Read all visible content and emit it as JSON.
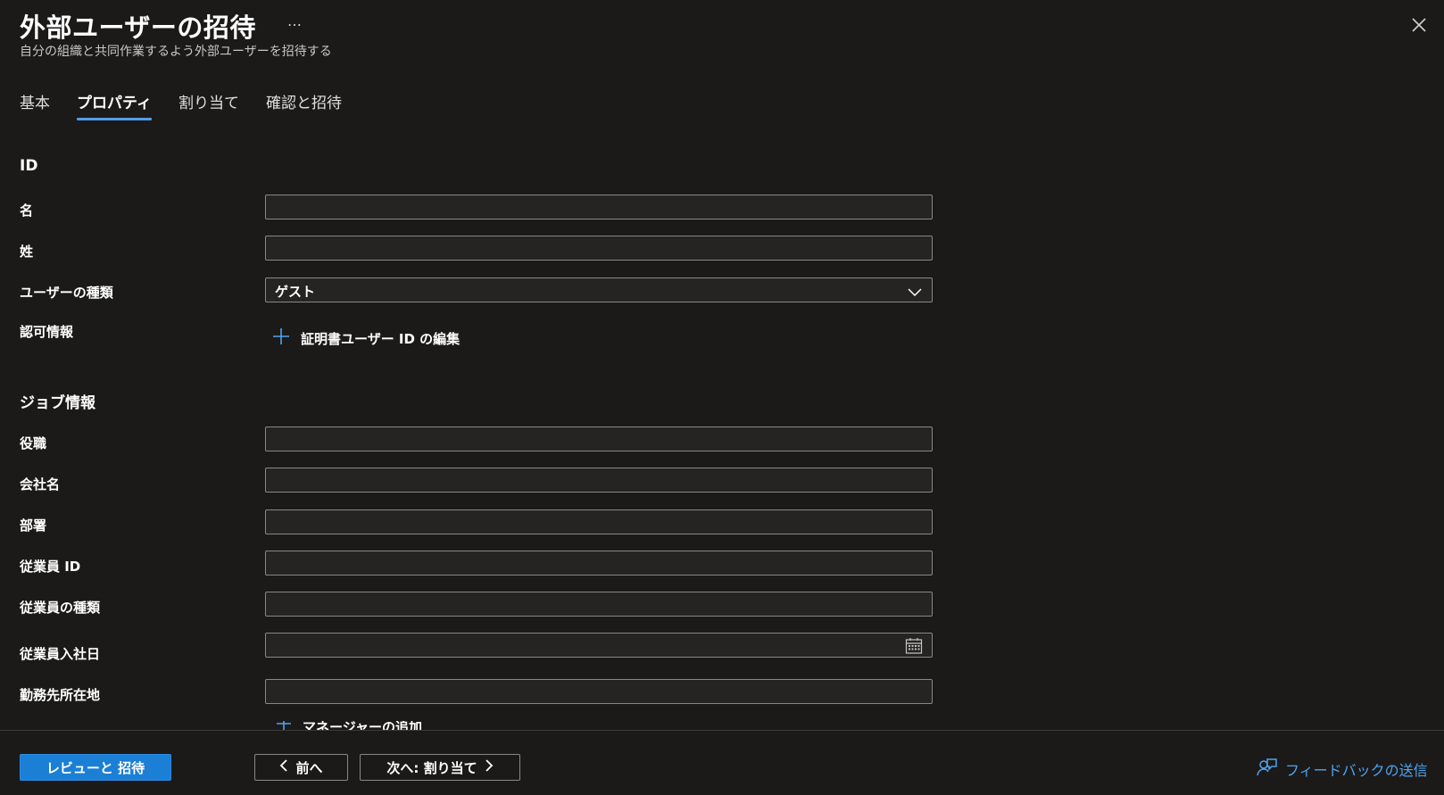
{
  "header": {
    "title": "外部ユーザーの招待",
    "more": "…",
    "subtitle": "自分の組織と共同作業するよう外部ユーザーを招待する"
  },
  "tabs": [
    {
      "label": "基本",
      "active": false
    },
    {
      "label": "プロパティ",
      "active": true
    },
    {
      "label": "割り当て",
      "active": false
    },
    {
      "label": "確認と招待",
      "active": false
    }
  ],
  "identity": {
    "heading": "ID",
    "first_name": {
      "label": "名",
      "value": ""
    },
    "last_name": {
      "label": "姓",
      "value": ""
    },
    "user_type": {
      "label": "ユーザーの種類",
      "value": "ゲスト"
    },
    "authorization": {
      "label": "認可情報",
      "link": "証明書ユーザー ID の編集"
    }
  },
  "job": {
    "heading": "ジョブ情報",
    "job_title": {
      "label": "役職",
      "value": ""
    },
    "company": {
      "label": "会社名",
      "value": ""
    },
    "department": {
      "label": "部署",
      "value": ""
    },
    "employee_id": {
      "label": "従業員 ID",
      "value": ""
    },
    "employee_type": {
      "label": "従業員の種類",
      "value": ""
    },
    "hire_date": {
      "label": "従業員入社日",
      "value": ""
    },
    "office_location": {
      "label": "勤務先所在地",
      "value": ""
    },
    "add_manager_cut": "マネージャーの追加"
  },
  "footer": {
    "review_invite": "レビューと 招待",
    "previous": "前へ",
    "next": "次へ: 割り当て",
    "feedback": "フィードバックの送信"
  },
  "colors": {
    "accent": "#1b7fd6",
    "link": "#4fa3f0",
    "background": "#1b1a19",
    "field_bg": "#252423",
    "tab_underline": "#4f9fe8"
  },
  "icons": [
    "ellipsis-icon",
    "close-icon",
    "plus-icon",
    "chevron-down-icon",
    "calendar-icon",
    "chevron-left-icon",
    "chevron-right-icon",
    "feedback-icon"
  ]
}
